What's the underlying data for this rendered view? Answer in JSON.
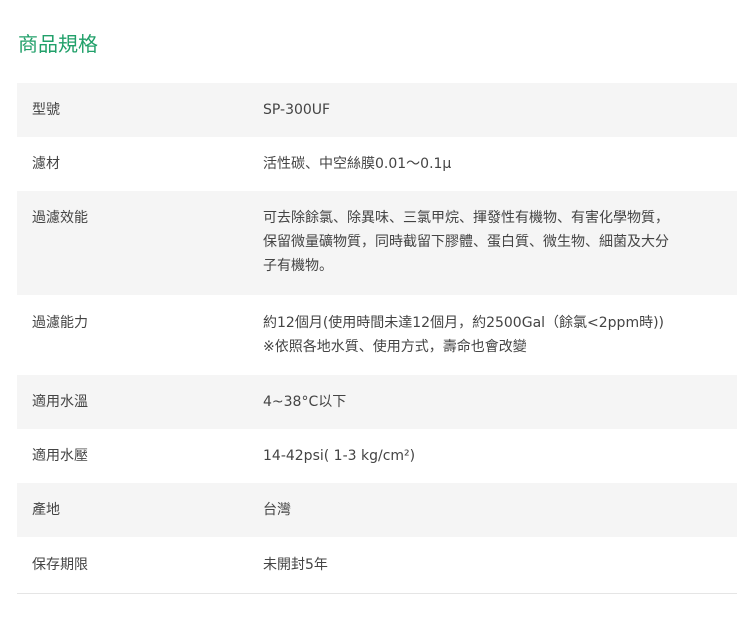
{
  "section": {
    "title": "商品規格"
  },
  "specs": [
    {
      "label": "型號",
      "lines": [
        "SP-300UF"
      ]
    },
    {
      "label": "濾材",
      "lines": [
        "活性碳、中空絲膜0.01〜0.1µ"
      ]
    },
    {
      "label": "過濾效能",
      "lines": [
        "可去除餘氯、除異味、三氯甲烷、揮發性有機物、有害化學物質，",
        "保留微量礦物質，同時截留下膠體、蛋白質、微生物、細菌及大分",
        "子有機物。"
      ]
    },
    {
      "label": "過濾能力",
      "lines": [
        "約12個月(使用時間未達12個月，約2500Gal（餘氯<2ppm時))",
        "※依照各地水質、使用方式，壽命也會改變"
      ]
    },
    {
      "label": "適用水溫",
      "lines": [
        "4~38°C以下"
      ]
    },
    {
      "label": "適用水壓",
      "lines": [
        "14-42psi( 1-3 kg/cm²)"
      ]
    },
    {
      "label": "產地",
      "lines": [
        "台灣"
      ]
    },
    {
      "label": "保存期限",
      "lines": [
        "未開封5年"
      ]
    }
  ]
}
